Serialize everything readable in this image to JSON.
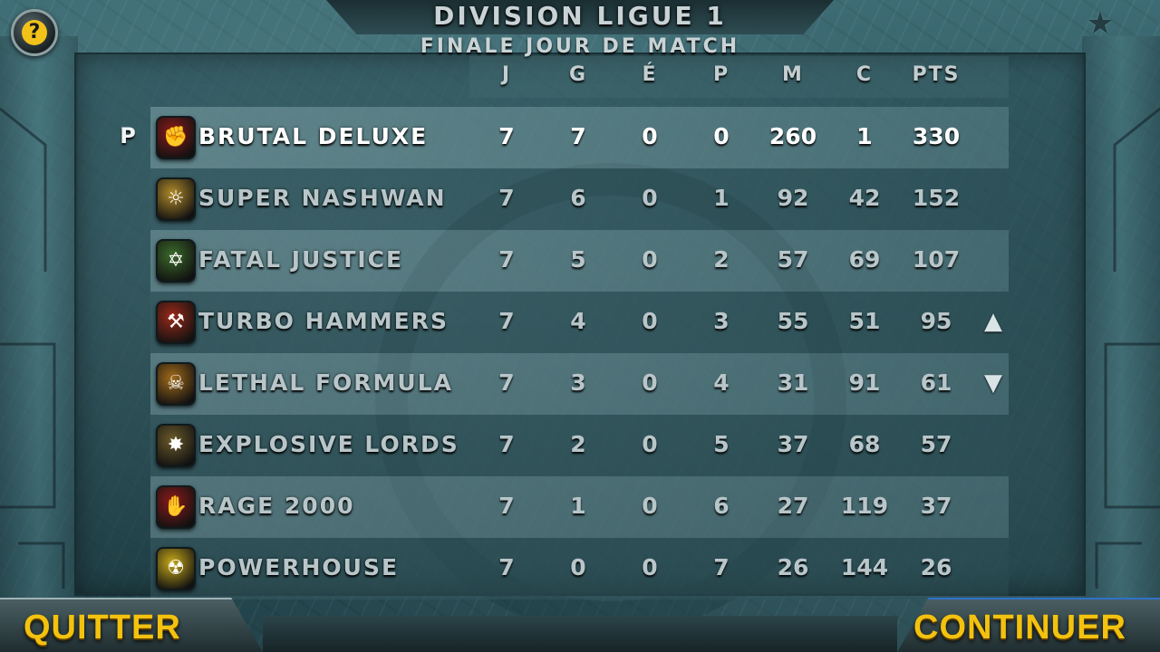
{
  "header": {
    "title": "DIVISION LIGUE 1",
    "subtitle": "FINALE JOUR DE MATCH"
  },
  "columns": [
    "J",
    "G",
    "É",
    "P",
    "M",
    "C",
    "PTS"
  ],
  "promotion_marker": "P",
  "teams": [
    {
      "name": "BRUTAL DELUXE",
      "icon": "brutal-deluxe-crest-icon",
      "badge_color": "#8a1a1a",
      "stats": [
        "7",
        "7",
        "0",
        "0",
        "260",
        "1",
        "330"
      ]
    },
    {
      "name": "SUPER NASHWAN",
      "icon": "super-nashwan-crest-icon",
      "badge_color": "#b08a2a",
      "stats": [
        "7",
        "6",
        "0",
        "1",
        "92",
        "42",
        "152"
      ]
    },
    {
      "name": "FATAL JUSTICE",
      "icon": "fatal-justice-crest-icon",
      "badge_color": "#3b6a2a",
      "stats": [
        "7",
        "5",
        "0",
        "2",
        "57",
        "69",
        "107"
      ]
    },
    {
      "name": "TURBO HAMMERS",
      "icon": "turbo-hammers-crest-icon",
      "badge_color": "#9a2a1a",
      "stats": [
        "7",
        "4",
        "0",
        "3",
        "55",
        "51",
        "95"
      ]
    },
    {
      "name": "LETHAL FORMULA",
      "icon": "lethal-formula-crest-icon",
      "badge_color": "#a06a1a",
      "stats": [
        "7",
        "3",
        "0",
        "4",
        "31",
        "91",
        "61"
      ]
    },
    {
      "name": "EXPLOSIVE LORDS",
      "icon": "explosive-lords-crest-icon",
      "badge_color": "#6a5a2a",
      "stats": [
        "7",
        "2",
        "0",
        "5",
        "37",
        "68",
        "57"
      ]
    },
    {
      "name": "RAGE 2000",
      "icon": "rage-2000-crest-icon",
      "badge_color": "#8a1a1a",
      "stats": [
        "7",
        "1",
        "0",
        "6",
        "27",
        "119",
        "37"
      ]
    },
    {
      "name": "POWERHOUSE",
      "icon": "powerhouse-crest-icon",
      "badge_color": "#c8a81a",
      "stats": [
        "7",
        "0",
        "0",
        "7",
        "26",
        "144",
        "26"
      ]
    }
  ],
  "buttons": {
    "quit": "QUITTER",
    "continue": "CONTINUER"
  },
  "icons": {
    "help": "question-mark-icon",
    "scroll_up": "scroll-up-arrow-icon",
    "scroll_down": "scroll-down-arrow-icon",
    "corner": "star-icon"
  },
  "colors": {
    "button_text": "#f3c20f",
    "help_icon": "#f2c21a"
  }
}
